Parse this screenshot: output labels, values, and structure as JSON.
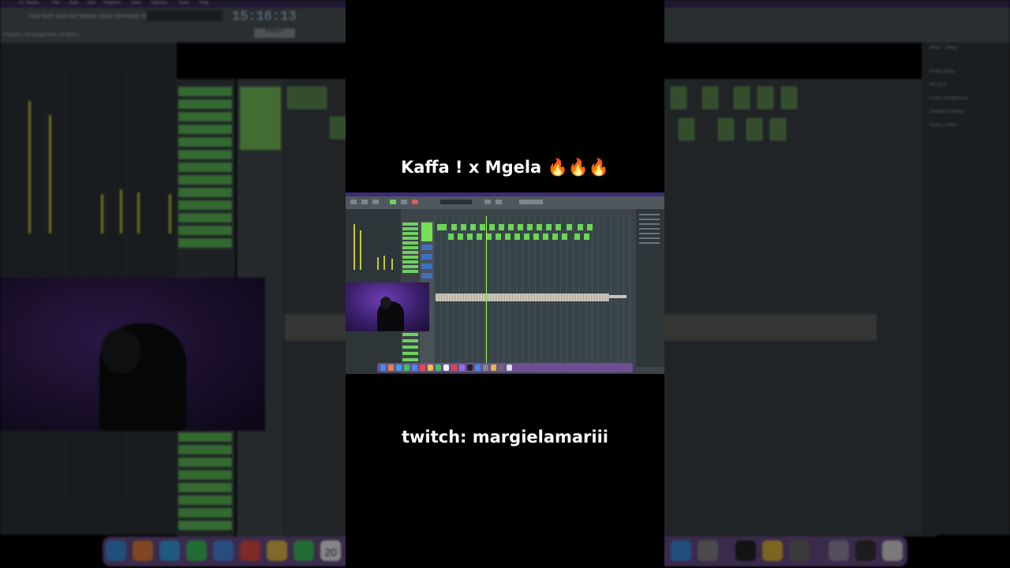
{
  "captions": {
    "title": "Kaffa ! x Mgela 🔥🔥🔥",
    "handle": "twitch: margielamariii"
  },
  "daw": {
    "app_name": "FL Studio",
    "menu": [
      "File",
      "Edit",
      "Add",
      "Patterns",
      "View",
      "Options",
      "Tools",
      "Help"
    ],
    "clock": "15:16:13",
    "hint": "FILE EDIT ADD PATTERNS VIEW OPTIONS TOOLS HELP",
    "channel_hint": "Playlist | Arrangement | Pattern",
    "pattern_button": "Pattern",
    "mixer_panel_title": "Mixer - Delay",
    "effects": [
      "Fruity Delay",
      "Pro-Q 3",
      "Fruity Compressor",
      "Doubler3 Stereo",
      "Fruity Limiter"
    ],
    "dock_date": "20"
  },
  "colors": {
    "accent_green": "#6fd05e",
    "meter_yellow": "#c7c834",
    "mac_purple": "#3b2d78"
  }
}
